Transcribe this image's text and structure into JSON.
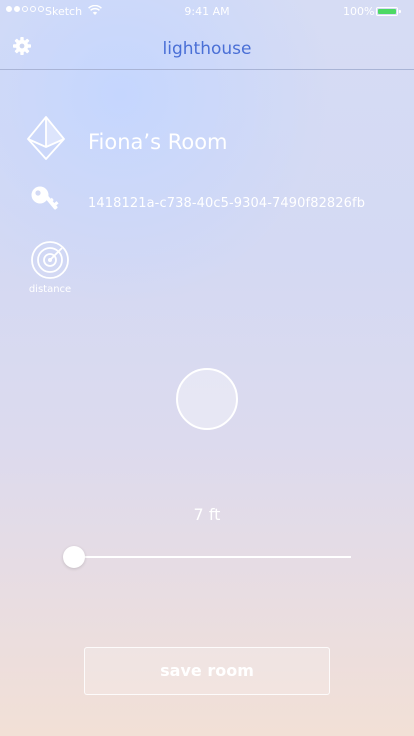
{
  "status_bar": {
    "carrier": "Sketch",
    "time": "9:41 AM",
    "battery_percent": "100%",
    "signal_dots_filled": 2,
    "signal_dots_total": 5,
    "battery_color": "#4cd964"
  },
  "nav": {
    "title": "lighthouse",
    "settings_icon": "gear-icon",
    "title_color": "#4a6fd6"
  },
  "room": {
    "name": "Fiona’s Room",
    "id": "1418121a-c738-40c5-9304-7490f82826fb",
    "name_icon": "diamond-beacon-icon",
    "id_icon": "key-icon"
  },
  "distance": {
    "label": "distance",
    "icon": "radar-icon",
    "value_text": "7 ft",
    "slider_level": 0.0
  },
  "actions": {
    "save_label": "save room"
  }
}
